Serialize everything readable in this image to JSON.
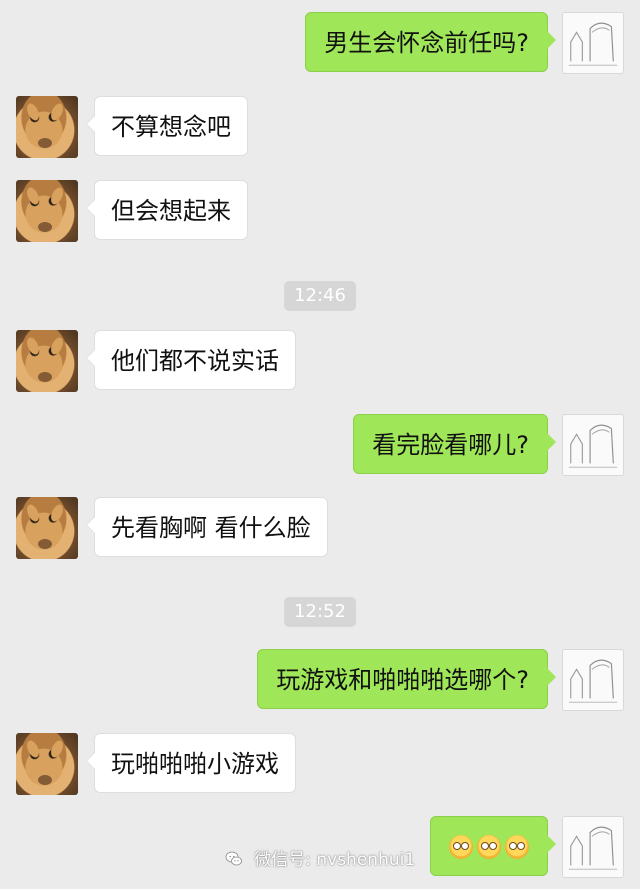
{
  "chat": {
    "messages": [
      {
        "side": "out",
        "text": "男生会怀念前任吗?"
      },
      {
        "side": "in",
        "text": "不算想念吧"
      },
      {
        "side": "in",
        "text": "但会想起来"
      },
      {
        "side": "time",
        "text": "12:46"
      },
      {
        "side": "in",
        "text": "他们都不说实话"
      },
      {
        "side": "out",
        "text": "看完脸看哪儿?"
      },
      {
        "side": "in",
        "text": "先看胸啊 看什么脸"
      },
      {
        "side": "time",
        "text": "12:52"
      },
      {
        "side": "out",
        "text": "玩游戏和啪啪啪选哪个?"
      },
      {
        "side": "in",
        "text": "玩啪啪啪小游戏"
      },
      {
        "side": "out",
        "text": "",
        "emoji": [
          "flushed-face-emoji",
          "flushed-face-emoji",
          "flushed-face-emoji"
        ]
      }
    ]
  },
  "watermark": {
    "text": "微信号: nvshenhui1"
  },
  "colors": {
    "background": "#ebebeb",
    "outgoing_bubble": "#9fe658",
    "incoming_bubble": "#ffffff",
    "timestamp_pill": "#d6d6d6"
  },
  "icons": {
    "incoming_avatar": "giraffe-avatar",
    "outgoing_avatar": "sketch-avatar",
    "watermark_icon": "wechat-icon"
  }
}
